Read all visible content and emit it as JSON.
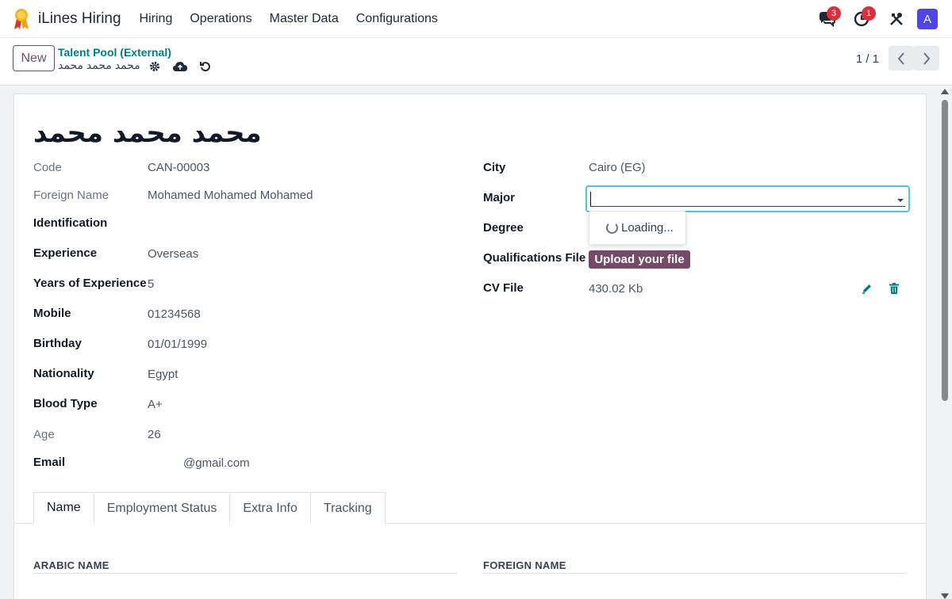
{
  "app": {
    "name": "iLines Hiring",
    "menu": [
      "Hiring",
      "Operations",
      "Master Data",
      "Configurations"
    ],
    "messages_count": "3",
    "activities_count": "1",
    "avatar_letter": "A"
  },
  "control": {
    "new_label": "New",
    "breadcrumb_parent": "Talent Pool (External)",
    "breadcrumb_current": "محمد محمد محمد",
    "pager": "1 / 1"
  },
  "record": {
    "name": "محمد محمد محمد"
  },
  "left_fields": {
    "code": {
      "label": "Code",
      "value": "CAN-00003"
    },
    "foreign_name": {
      "label": "Foreign Name",
      "value": "Mohamed Mohamed Mohamed"
    },
    "identification": {
      "label": "Identification",
      "value": ""
    },
    "experience": {
      "label": "Experience",
      "value": "Overseas"
    },
    "years_experience": {
      "label": "Years of Experience",
      "value": "5"
    },
    "mobile": {
      "label": "Mobile",
      "value": "01234568"
    },
    "birthday": {
      "label": "Birthday",
      "value": "01/01/1999"
    },
    "nationality": {
      "label": "Nationality",
      "value": "Egypt"
    },
    "blood_type": {
      "label": "Blood Type",
      "value": "A+"
    },
    "age": {
      "label": "Age",
      "value": "26"
    },
    "email": {
      "label": "Email",
      "value": "@gmail.com"
    }
  },
  "right_fields": {
    "city": {
      "label": "City",
      "value": "Cairo (EG)"
    },
    "major": {
      "label": "Major",
      "value": "",
      "dropdown_text": "Loading..."
    },
    "degree": {
      "label": "Degree",
      "value": ""
    },
    "qualifications_file": {
      "label": "Qualifications File",
      "button": "Upload your file"
    },
    "cv_file": {
      "label": "CV File",
      "value": "430.02 Kb"
    }
  },
  "tabs": [
    "Name",
    "Employment Status",
    "Extra Info",
    "Tracking"
  ],
  "name_tab": {
    "arabic_name_title": "ARABIC NAME",
    "foreign_name_title": "FOREIGN NAME"
  },
  "colors": {
    "brand": "#714b67",
    "teal": "#017e84",
    "focus": "#4fc3dd",
    "badge": "#e02d3c"
  }
}
